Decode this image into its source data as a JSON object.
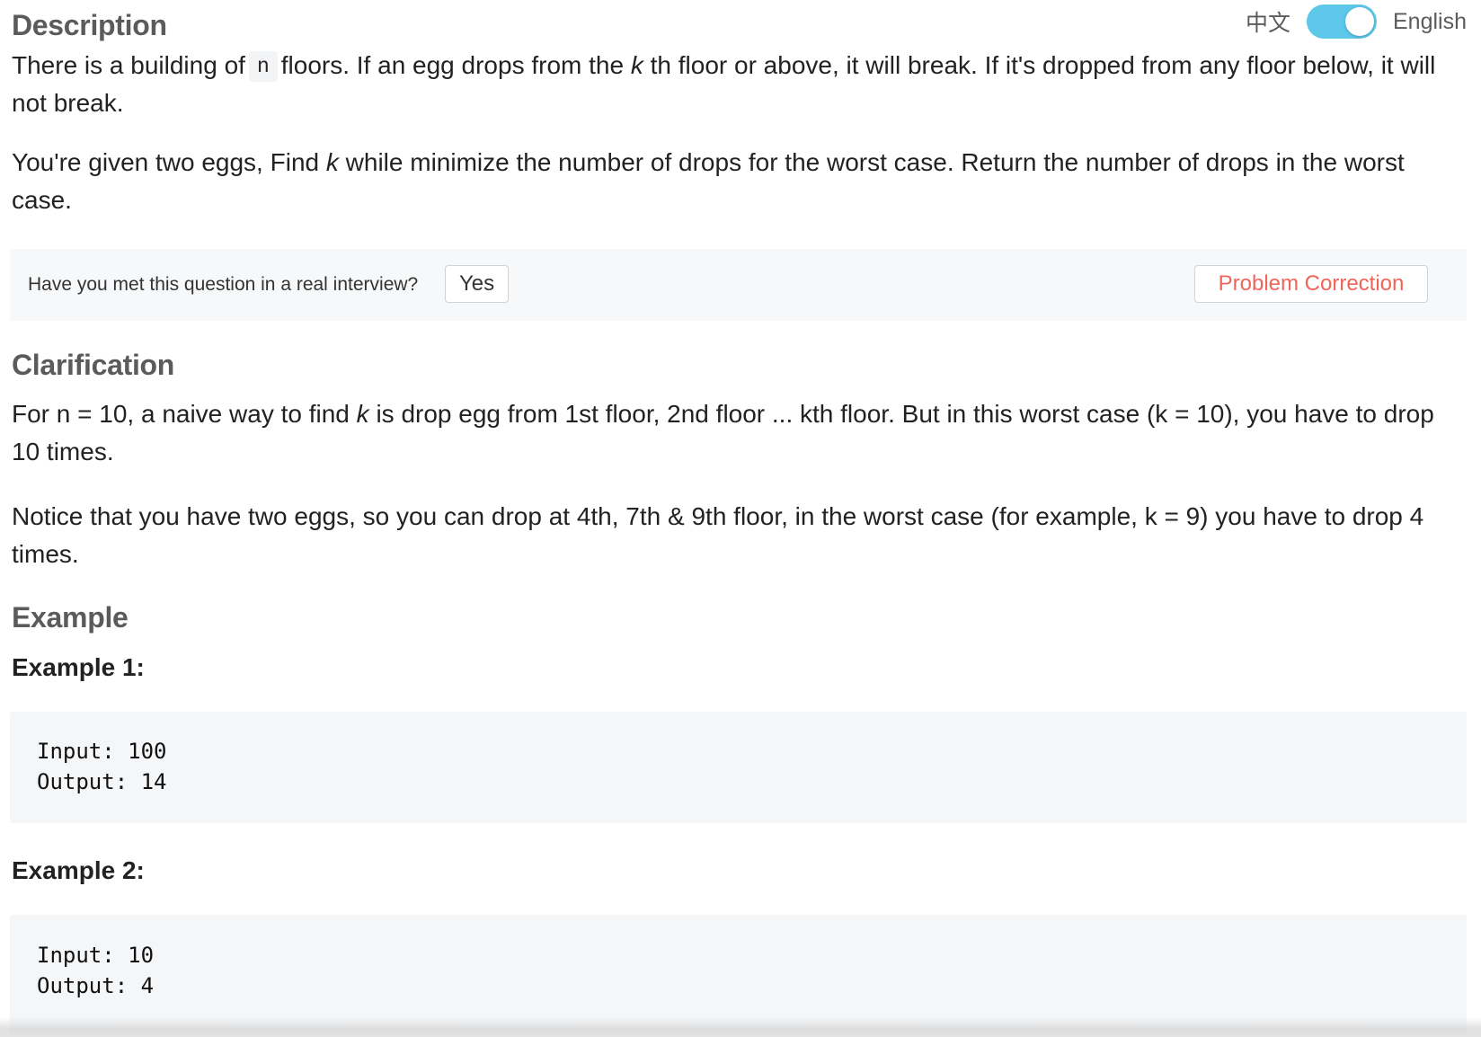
{
  "lang_toggle": {
    "chinese_label": "中文",
    "english_label": "English",
    "selected": "English"
  },
  "description": {
    "title": "Description",
    "p1_part1": "There is a building of",
    "p1_code": "n",
    "p1_part2": "floors. If an egg drops from the",
    "p1_k": "k",
    "p1_part3": "th floor or above, it will break. If it's dropped from any floor below, it will not break.",
    "p2_part1": "You're given two eggs, Find",
    "p2_k": "k",
    "p2_part2": "while minimize the number of drops for the worst case. Return the number of drops in the worst case."
  },
  "interview_bar": {
    "question": "Have you met this question in a real interview?",
    "yes_label": "Yes",
    "correction_label": "Problem Correction"
  },
  "clarification": {
    "title": "Clarification",
    "p1_part1": "For n = 10, a naive way to find",
    "p1_k": "k",
    "p1_part2": "is drop egg from 1st floor, 2nd floor ... kth floor. But in this worst case (k = 10), you have to drop 10 times.",
    "p2": "Notice that you have two eggs, so you can drop at 4th, 7th & 9th floor, in the worst case (for example, k = 9) you have to drop 4 times."
  },
  "example": {
    "title": "Example",
    "examples": [
      {
        "title": "Example 1:",
        "input": "Input: 100",
        "output": "Output: 14"
      },
      {
        "title": "Example 2:",
        "input": "Input: 10",
        "output": "Output: 4"
      }
    ]
  },
  "colors": {
    "toggle_on": "#5ec8ea",
    "correction_text": "#f0655a",
    "section_title": "#5b5b5b"
  }
}
